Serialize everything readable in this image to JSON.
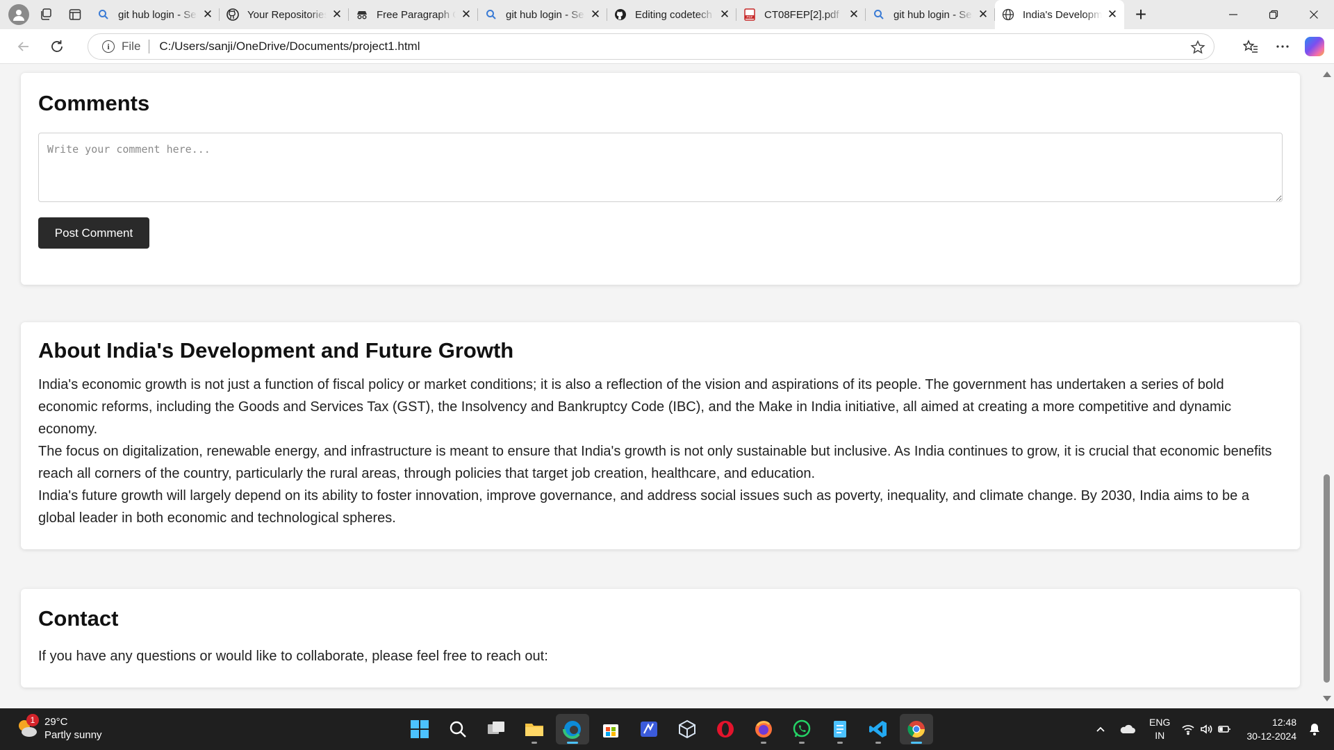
{
  "browser": {
    "tabs": [
      {
        "title": "git hub login - Search",
        "icon": "search-icon"
      },
      {
        "title": "Your Repositories",
        "icon": "github-icon"
      },
      {
        "title": "Free Paragraph Generator",
        "icon": "incognito-icon"
      },
      {
        "title": "git hub login - Search",
        "icon": "search-icon"
      },
      {
        "title": "Editing codetech",
        "icon": "github-icon"
      },
      {
        "title": "CT08FEP[2].pdf",
        "icon": "pdf-icon"
      },
      {
        "title": "git hub login - Search",
        "icon": "search-icon"
      },
      {
        "title": "India's Development",
        "icon": "globe-icon",
        "active": true
      }
    ],
    "address": {
      "scheme": "File",
      "url": "C:/Users/sanji/OneDrive/Documents/project1.html"
    }
  },
  "page": {
    "comments": {
      "heading": "Comments",
      "placeholder": "Write your comment here...",
      "post_button": "Post Comment"
    },
    "about": {
      "heading": "About India's Development and Future Growth",
      "paragraphs": [
        "India's economic growth is not just a function of fiscal policy or market conditions; it is also a reflection of the vision and aspirations of its people. The government has undertaken a series of bold economic reforms, including the Goods and Services Tax (GST), the Insolvency and Bankruptcy Code (IBC), and the Make in India initiative, all aimed at creating a more competitive and dynamic economy.",
        "The focus on digitalization, renewable energy, and infrastructure is meant to ensure that India's growth is not only sustainable but inclusive. As India continues to grow, it is crucial that economic benefits reach all corners of the country, particularly the rural areas, through policies that target job creation, healthcare, and education.",
        "India's future growth will largely depend on its ability to foster innovation, improve governance, and address social issues such as poverty, inequality, and climate change. By 2030, India aims to be a global leader in both economic and technological spheres."
      ]
    },
    "contact": {
      "heading": "Contact",
      "text": "If you have any questions or would like to collaborate, please feel free to reach out:"
    }
  },
  "taskbar": {
    "weather": {
      "temp": "29°C",
      "condition": "Partly sunny",
      "badge": "1"
    },
    "apps": [
      "windows-start-icon",
      "search-icon",
      "task-view-icon",
      "file-explorer-icon",
      "edge-icon",
      "microsoft-store-icon",
      "powerautomate-icon",
      "virtualbox-icon",
      "opera-icon",
      "firefox-icon",
      "whatsapp-icon",
      "notepad-icon",
      "vscode-icon",
      "chrome-icon"
    ],
    "language": {
      "line1": "ENG",
      "line2": "IN"
    },
    "clock": {
      "time": "12:48",
      "date": "30-12-2024"
    }
  },
  "colors": {
    "accent": "#4cc2ff",
    "button_dark": "#2a2a2a",
    "taskbar": "#1f1f1f"
  }
}
